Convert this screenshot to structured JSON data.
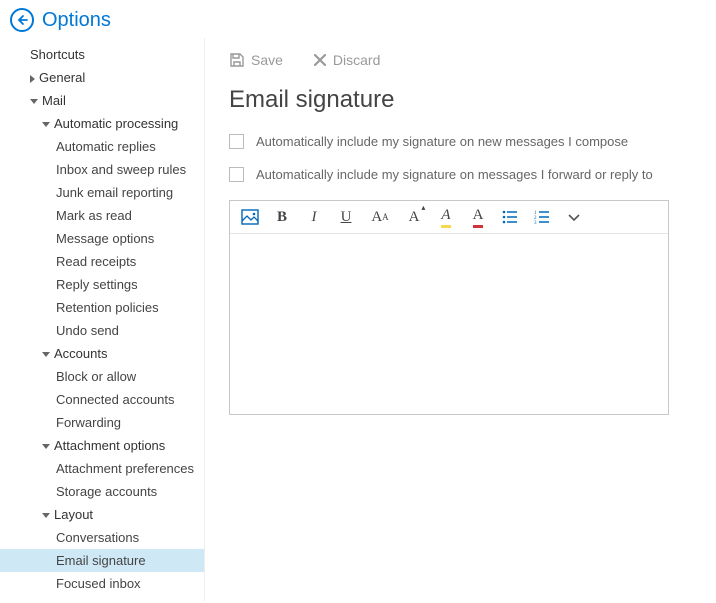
{
  "header": {
    "title": "Options"
  },
  "toolbar": {
    "save": "Save",
    "discard": "Discard"
  },
  "page": {
    "title": "Email signature"
  },
  "options": {
    "auto_new": "Automatically include my signature on new messages I compose",
    "auto_fwd": "Automatically include my signature on messages I forward or reply to"
  },
  "nav": {
    "shortcuts": "Shortcuts",
    "general": "General",
    "mail": "Mail",
    "auto_processing": "Automatic processing",
    "auto_replies": "Automatic replies",
    "inbox_sweep": "Inbox and sweep rules",
    "junk": "Junk email reporting",
    "mark_read": "Mark as read",
    "msg_options": "Message options",
    "read_receipts": "Read receipts",
    "reply_settings": "Reply settings",
    "retention": "Retention policies",
    "undo_send": "Undo send",
    "accounts": "Accounts",
    "block_allow": "Block or allow",
    "connected": "Connected accounts",
    "forwarding": "Forwarding",
    "attach_opts": "Attachment options",
    "attach_prefs": "Attachment preferences",
    "storage": "Storage accounts",
    "layout": "Layout",
    "conversations": "Conversations",
    "email_sig": "Email signature",
    "focused": "Focused inbox"
  }
}
